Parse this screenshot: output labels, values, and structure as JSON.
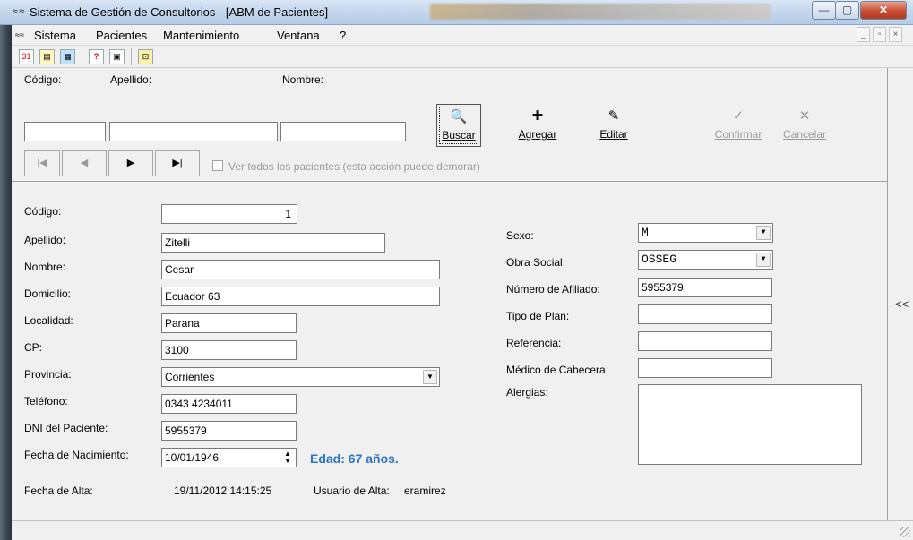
{
  "window": {
    "title": "Sistema de Gestión de Consultorios - [ABM de Pacientes]",
    "app_icon": "app-icon",
    "controls": {
      "minimize": "—",
      "maximize": "▢",
      "close": "✕"
    }
  },
  "menu": {
    "items": [
      "Sistema",
      "Pacientes",
      "Mantenimiento",
      "Ventana",
      "?"
    ],
    "mdi_controls": [
      "_",
      "▫",
      "×"
    ]
  },
  "toolbar": {
    "icons": [
      "calendar-icon",
      "notes-icon",
      "image-icon",
      "help-icon",
      "document-icon",
      "exit-icon"
    ],
    "glyphs": [
      "31",
      "▤",
      "▦",
      "?",
      "▣",
      "⊡"
    ]
  },
  "search": {
    "codigo_label": "Código:",
    "apellido_label": "Apellido:",
    "nombre_label": "Nombre:",
    "codigo_value": "",
    "apellido_value": "",
    "nombre_value": "",
    "buscar_label": "Buscar",
    "agregar_label": "Agregar",
    "editar_label": "Editar",
    "confirmar_label": "Confirmar",
    "cancelar_label": "Cancelar",
    "buscar_icon": "🔍",
    "agregar_icon": "✚",
    "editar_icon": "✎",
    "confirmar_icon": "✓",
    "cancelar_icon": "✕",
    "nav": {
      "first": "|◀",
      "prev": "◀",
      "next": "▶",
      "last": "▶|"
    },
    "ver_todos_label": "Ver todos los pacientes (esta acción puede demorar)"
  },
  "form": {
    "labels": {
      "codigo": "Código:",
      "apellido": "Apellido:",
      "nombre": "Nombre:",
      "domicilio": "Domicilio:",
      "localidad": "Localidad:",
      "cp": "CP:",
      "provincia": "Provincia:",
      "telefono": "Teléfono:",
      "dni": "DNI del Paciente:",
      "fecha_nacimiento": "Fecha de Nacimiento:",
      "fecha_alta": "Fecha de Alta:",
      "usuario_alta": "Usuario de Alta:",
      "sexo": "Sexo:",
      "obra_social": "Obra Social:",
      "numero_afiliado": "Número de Afiliado:",
      "tipo_plan": "Tipo de Plan:",
      "referencia": "Referencia:",
      "medico_cabecera": "Médico de Cabecera:",
      "alergias": "Alergias:"
    },
    "values": {
      "codigo": "1",
      "apellido": "Zitelli",
      "nombre": "Cesar",
      "domicilio": "Ecuador 63",
      "localidad": "Parana",
      "cp": "3100",
      "provincia": "Corrientes",
      "telefono": "0343 4234011",
      "dni": "5955379",
      "fecha_nacimiento": "10/01/1946",
      "edad": "Edad: 67 años.",
      "fecha_alta": "19/11/2012 14:15:25",
      "usuario_alta": "eramirez",
      "sexo": "M",
      "obra_social": "OSSEG",
      "numero_afiliado": "5955379",
      "tipo_plan": "",
      "referencia": "",
      "medico_cabecera": "",
      "alergias": ""
    },
    "dropdown_arrow": "▼",
    "spin_up": "▲",
    "spin_down": "▼"
  },
  "side_panel": {
    "collapse_label": "<<"
  }
}
